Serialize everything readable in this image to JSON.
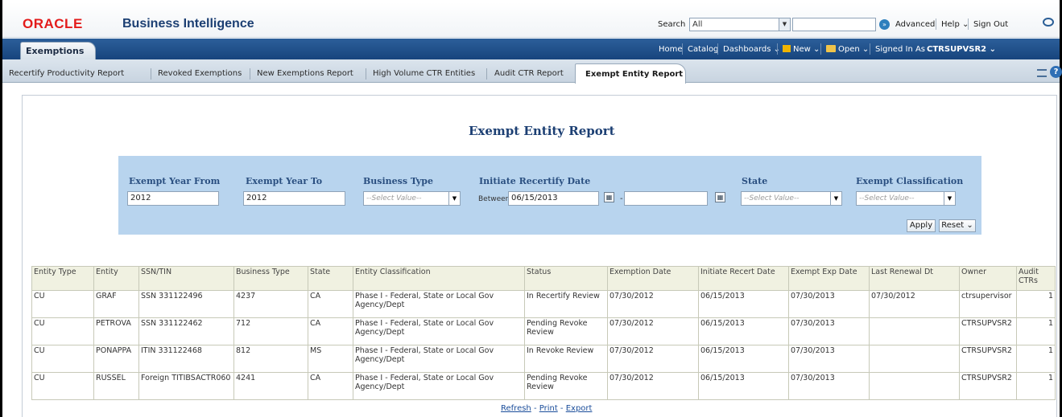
{
  "header": {
    "logo": "ORACLE",
    "app_title": "Business Intelligence",
    "search_label": "Search",
    "search_scope": "All",
    "links": [
      "Advanced",
      "Help ⌄",
      "Sign Out"
    ]
  },
  "nav": {
    "dashboard_tab": "Exemptions",
    "home": "Home",
    "catalog": "Catalog",
    "dashboards": "Dashboards ⌄",
    "new": "New ⌄",
    "open": "Open ⌄",
    "signed_in_prefix": "Signed In As",
    "signed_in_user": "CTRSUPVSR2 ⌄"
  },
  "page_tabs": {
    "items": [
      "Recertify Productivity Report",
      "Revoked Exemptions",
      "New Exemptions Report",
      "High Volume CTR Entities",
      "Audit CTR Report"
    ],
    "active": "Exempt Entity Report"
  },
  "report": {
    "title": "Exempt Entity Report"
  },
  "prompts": {
    "year_from_label": "Exempt Year From",
    "year_from_value": "2012",
    "year_to_label": "Exempt Year To",
    "year_to_value": "2012",
    "business_type_label": "Business Type",
    "business_type_value": "--Select Value--",
    "recertify_label": "Initiate Recertify Date",
    "between_label": "Between",
    "recertify_from": "06/15/2013",
    "recertify_to": "",
    "state_label": "State",
    "state_value": "--Select Value--",
    "classification_label": "Exempt Classification",
    "classification_value": "--Select Value--",
    "apply_label": "Apply",
    "reset_label": "Reset ⌄"
  },
  "table": {
    "headers": [
      "Entity Type",
      "Entity",
      "SSN/TIN",
      "Business Type",
      "State",
      "Entity Classification",
      "Status",
      "Exemption Date",
      "Initiate Recert Date",
      "Exempt Exp Date",
      "Last Renewal Dt",
      "Owner",
      "Audit CTRs"
    ],
    "rows": [
      [
        "CU",
        "GRAF",
        "SSN 331122496",
        "4237",
        "CA",
        "Phase I - Federal, State or Local Gov Agency/Dept",
        "In Recertify Review",
        "07/30/2012",
        "06/15/2013",
        "07/30/2013",
        "07/30/2012",
        "ctrsupervisor",
        "1"
      ],
      [
        "CU",
        "PETROVA",
        "SSN 331122462",
        "712",
        "CA",
        "Phase I - Federal, State or Local Gov Agency/Dept",
        "Pending Revoke Review",
        "07/30/2012",
        "06/15/2013",
        "07/30/2013",
        "",
        "CTRSUPVSR2",
        "1"
      ],
      [
        "CU",
        "PONAPPA",
        "ITIN 331122468",
        "812",
        "MS",
        "Phase I - Federal, State or Local Gov Agency/Dept",
        "In Revoke Review",
        "07/30/2012",
        "06/15/2013",
        "07/30/2013",
        "",
        "CTRSUPVSR2",
        "1"
      ],
      [
        "CU",
        "RUSSEL",
        "Foreign TITIBSACTR060",
        "4241",
        "CA",
        "Phase I - Federal, State or Local Gov Agency/Dept",
        "Pending Revoke Review",
        "07/30/2012",
        "06/15/2013",
        "07/30/2013",
        "",
        "CTRSUPVSR2",
        "1"
      ]
    ]
  },
  "footer": {
    "refresh": "Refresh",
    "print": "Print",
    "export": "Export",
    "sep": " - "
  },
  "colors": {
    "nav_blue": "#1f4f8a",
    "prompt_bg": "#b8d4ee",
    "logo_red": "#e31b1b",
    "title_blue": "#1c3f73",
    "table_header_bg": "#f0f1e1"
  }
}
